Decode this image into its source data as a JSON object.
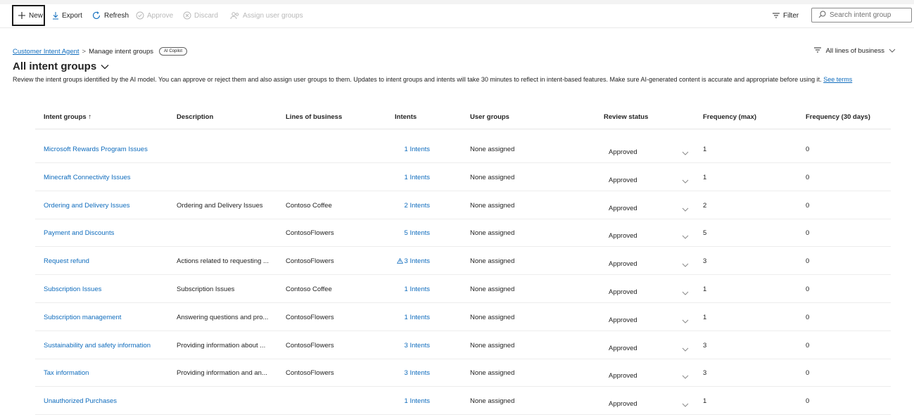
{
  "toolbar": {
    "new": "New",
    "export": "Export",
    "refresh": "Refresh",
    "approve": "Approve",
    "discard": "Discard",
    "assign": "Assign user groups",
    "filter": "Filter",
    "search_placeholder": "Search intent group"
  },
  "breadcrumb": {
    "root": "Customer Intent Agent",
    "separator": ">",
    "current": "Manage intent groups",
    "badge": "AI Copilot"
  },
  "lob_filter": "All lines of business",
  "page_title": "All intent groups",
  "description": {
    "text": "Review the intent groups identified by the AI model. You can approve or reject them and also assign user groups to them. Updates to intent groups and intents will take 30 minutes to reflect in intent-based features. Make sure AI-generated content is accurate and appropriate before using it.",
    "link": "See terms"
  },
  "table": {
    "headers": {
      "name": "Intent groups ↑",
      "description": "Description",
      "lob": "Lines of business",
      "intents": "Intents",
      "user_groups": "User groups",
      "review": "Review status",
      "freq_max": "Frequency (max)",
      "freq_30": "Frequency (30 days)"
    },
    "rows": [
      {
        "name": "Microsoft Rewards Program Issues",
        "description": "",
        "lob": "",
        "intents": "1 Intents",
        "warning": false,
        "user_groups": "None assigned",
        "review": "Approved",
        "freq_max": "1",
        "freq_30": "0"
      },
      {
        "name": "Minecraft Connectivity Issues",
        "description": "",
        "lob": "",
        "intents": "1 Intents",
        "warning": false,
        "user_groups": "None assigned",
        "review": "Approved",
        "freq_max": "1",
        "freq_30": "0"
      },
      {
        "name": "Ordering and Delivery Issues",
        "description": "Ordering and Delivery Issues",
        "lob": "Contoso Coffee",
        "intents": "2 Intents",
        "warning": false,
        "user_groups": "None assigned",
        "review": "Approved",
        "freq_max": "2",
        "freq_30": "0"
      },
      {
        "name": "Payment and Discounts",
        "description": "",
        "lob": "ContosoFlowers",
        "intents": "5 Intents",
        "warning": false,
        "user_groups": "None assigned",
        "review": "Approved",
        "freq_max": "5",
        "freq_30": "0"
      },
      {
        "name": "Request refund",
        "description": "Actions related to requesting ...",
        "lob": "ContosoFlowers",
        "intents": "3 Intents",
        "warning": true,
        "user_groups": "None assigned",
        "review": "Approved",
        "freq_max": "3",
        "freq_30": "0"
      },
      {
        "name": "Subscription Issues",
        "description": "Subscription Issues",
        "lob": "Contoso Coffee",
        "intents": "1 Intents",
        "warning": false,
        "user_groups": "None assigned",
        "review": "Approved",
        "freq_max": "1",
        "freq_30": "0"
      },
      {
        "name": "Subscription management",
        "description": "Answering questions and pro...",
        "lob": "ContosoFlowers",
        "intents": "1 Intents",
        "warning": false,
        "user_groups": "None assigned",
        "review": "Approved",
        "freq_max": "1",
        "freq_30": "0"
      },
      {
        "name": "Sustainability and safety information",
        "description": "Providing information about ...",
        "lob": "ContosoFlowers",
        "intents": "3 Intents",
        "warning": false,
        "user_groups": "None assigned",
        "review": "Approved",
        "freq_max": "3",
        "freq_30": "0"
      },
      {
        "name": "Tax information",
        "description": "Providing information and an...",
        "lob": "ContosoFlowers",
        "intents": "3 Intents",
        "warning": false,
        "user_groups": "None assigned",
        "review": "Approved",
        "freq_max": "3",
        "freq_30": "0"
      },
      {
        "name": "Unauthorized Purchases",
        "description": "",
        "lob": "",
        "intents": "1 Intents",
        "warning": false,
        "user_groups": "None assigned",
        "review": "Approved",
        "freq_max": "1",
        "freq_30": "0"
      }
    ]
  },
  "colors": {
    "link": "#0f6cbd",
    "text": "#242424",
    "disabled": "#b9b9b9",
    "divider": "#ededed"
  }
}
